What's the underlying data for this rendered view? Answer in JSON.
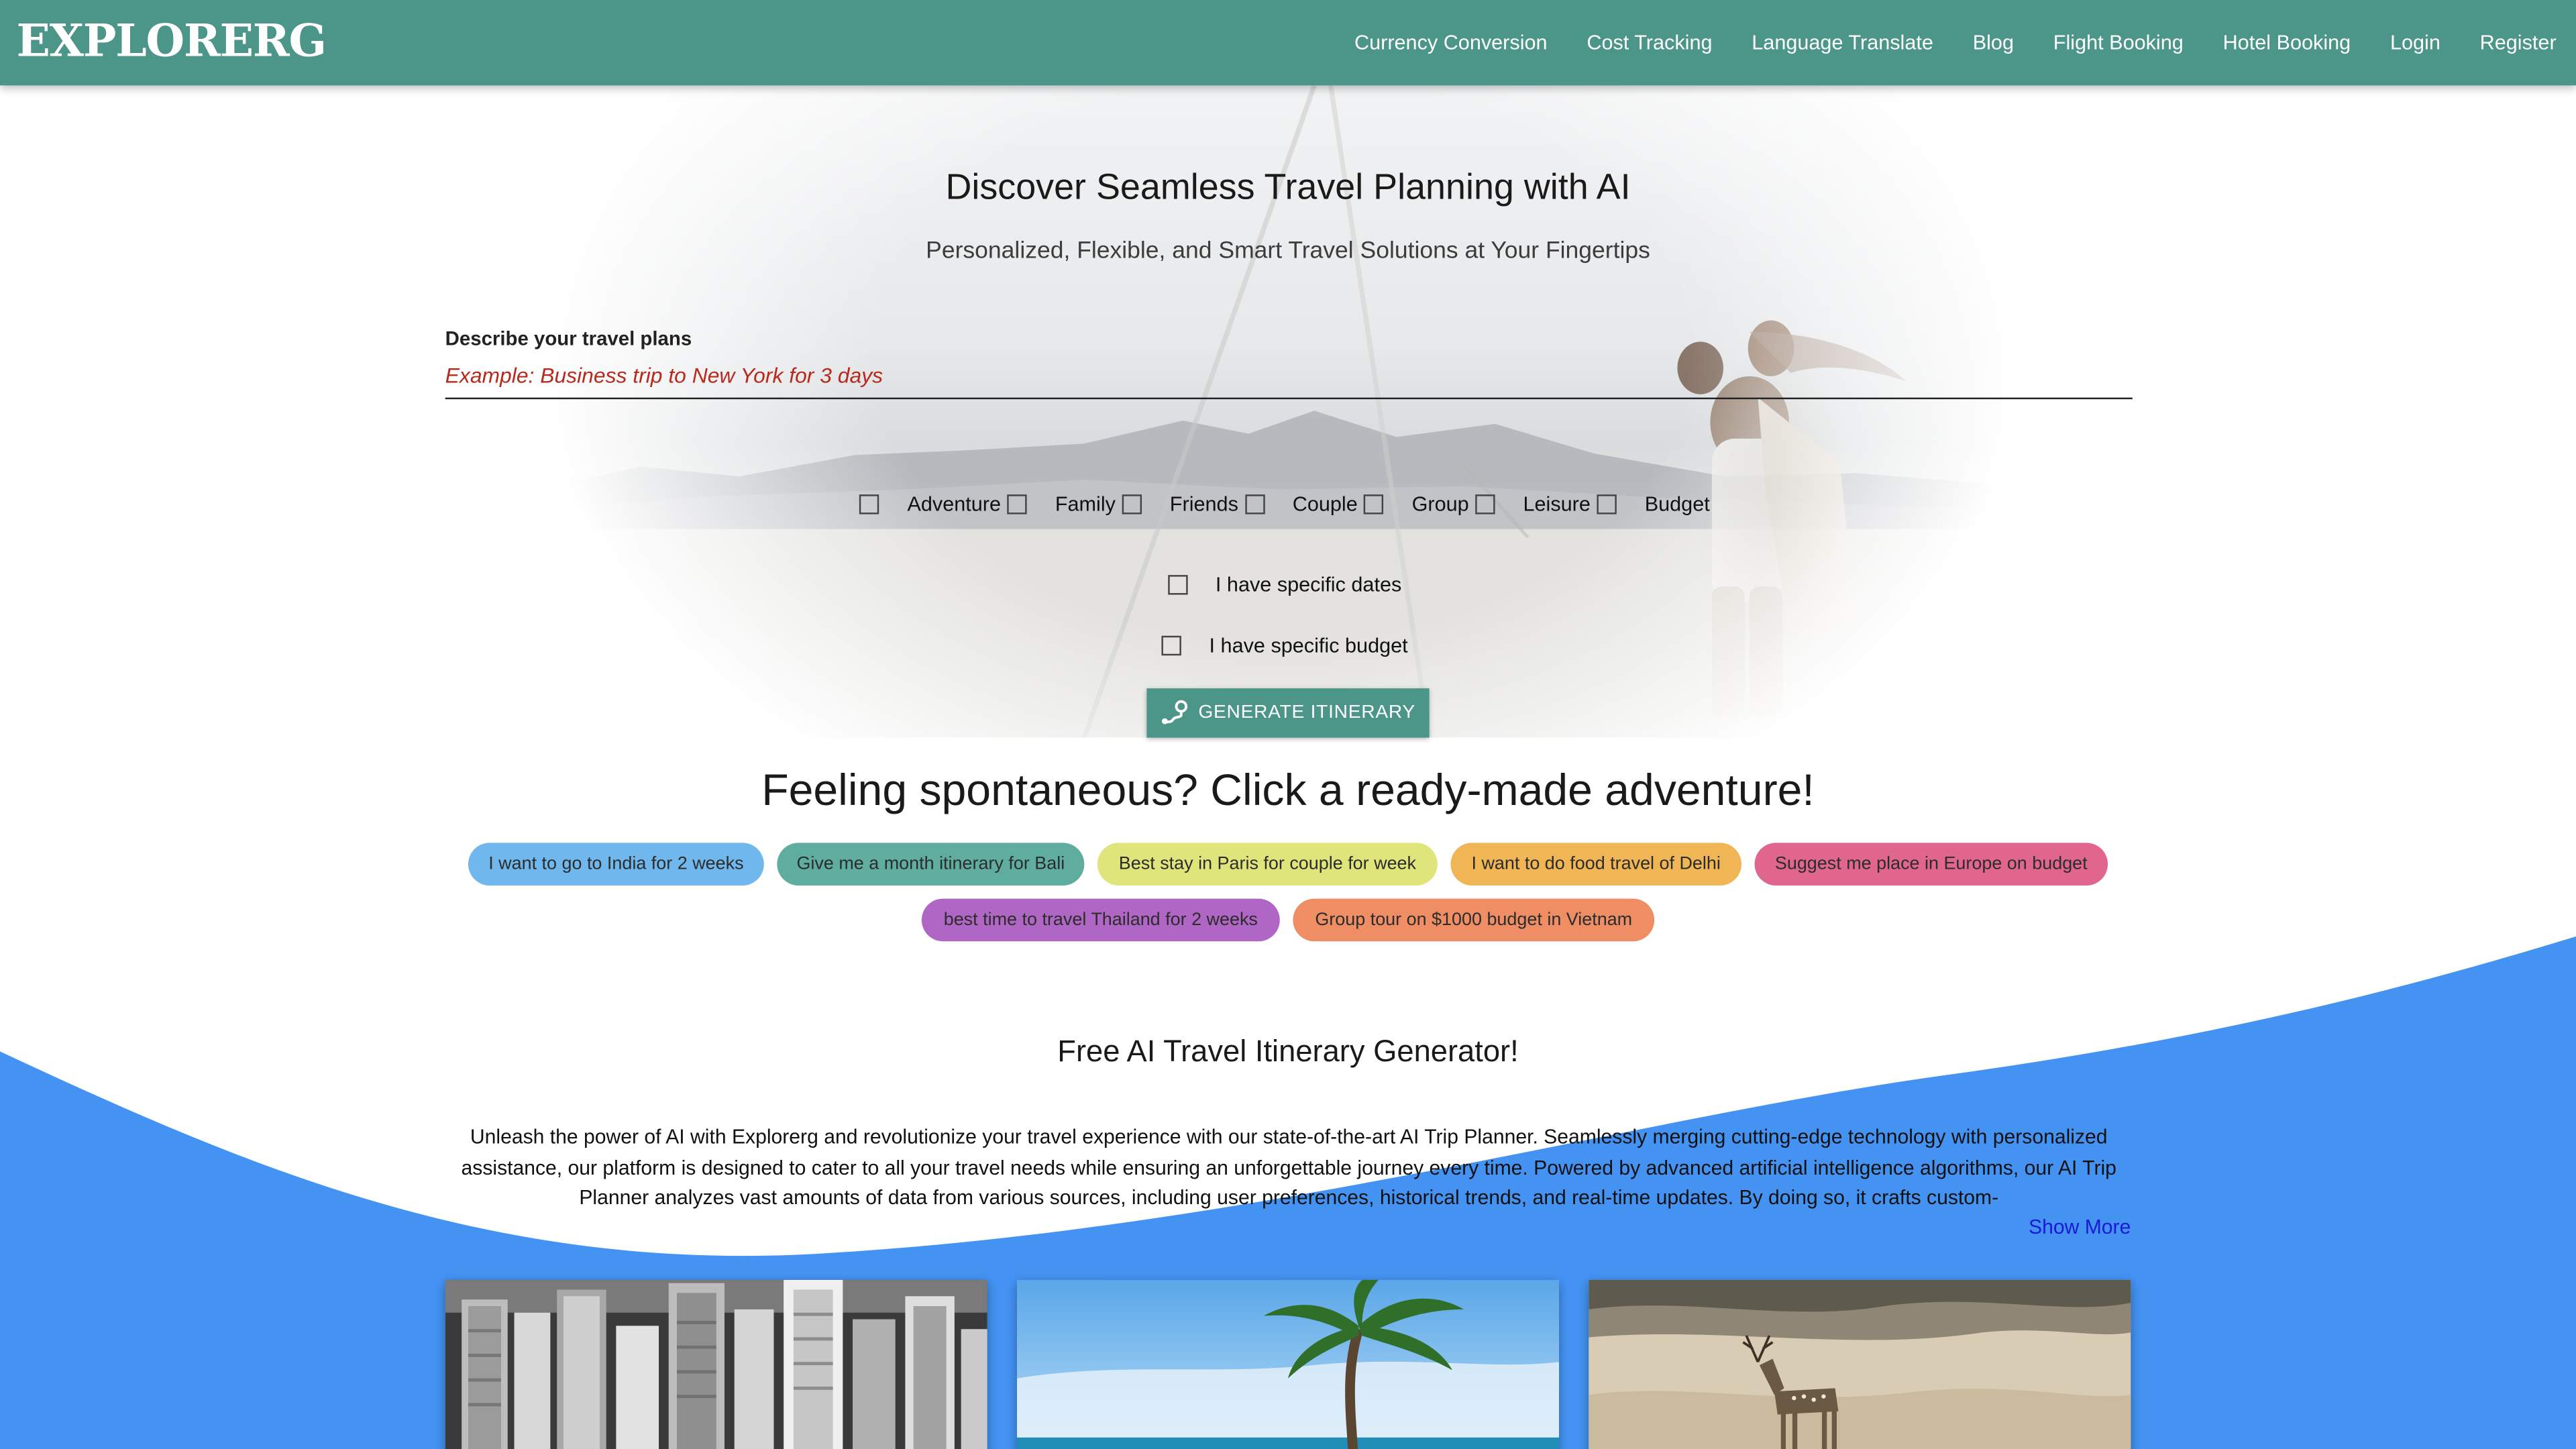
{
  "header": {
    "logo": "EXPLORERG",
    "nav": [
      "Currency Conversion",
      "Cost Tracking",
      "Language Translate",
      "Blog",
      "Flight Booking",
      "Hotel Booking",
      "Login",
      "Register"
    ]
  },
  "hero": {
    "title": "Discover Seamless Travel Planning with AI",
    "subtitle": "Personalized, Flexible, and Smart Travel Solutions at Your Fingertips",
    "input_label": "Describe your travel plans",
    "input_placeholder": "Example: Business trip to New York for 3 days",
    "input_value": "",
    "trip_types": [
      "Adventure",
      "Family",
      "Friends",
      "Couple",
      "Group",
      "Leisure",
      "Budget"
    ],
    "specific_dates_label": "I have specific dates",
    "specific_budget_label": "I have specific budget",
    "generate_button": "GENERATE ITINERARY"
  },
  "spontaneous": {
    "title": "Feeling spontaneous? Click a ready-made adventure!",
    "chips": [
      {
        "label": "I want to go to India for 2 weeks",
        "color": "#6fb7ec"
      },
      {
        "label": "Give me a month itinerary for Bali",
        "color": "#5fad9f"
      },
      {
        "label": "Best stay in Paris for couple for week",
        "color": "#dfe57b"
      },
      {
        "label": "I want to do food travel of Delhi",
        "color": "#f0b655"
      },
      {
        "label": "Suggest me place in Europe on budget",
        "color": "#e0668e"
      },
      {
        "label": "best time to travel Thailand for 2 weeks",
        "color": "#b066c4"
      },
      {
        "label": "Group tour on $1000 budget in Vietnam",
        "color": "#ef8e64"
      }
    ]
  },
  "free_generator": {
    "title": "Free AI Travel Itinerary Generator!",
    "body": "Unleash the power of AI with Explorerg and revolutionize your travel experience with our state-of-the-art AI Trip Planner. Seamlessly merging cutting-edge technology with personalized assistance, our platform is designed to cater to all your travel needs while ensuring an unforgettable journey every time. Powered by advanced artificial intelligence algorithms, our AI Trip Planner analyzes vast amounts of data from various sources, including user preferences, historical trends, and real-time updates. By doing so, it crafts custom-",
    "show_more": "Show More"
  },
  "colors": {
    "brand": "#4b9589",
    "wave_blue": "#4493f3",
    "placeholder_red": "#b8291b",
    "link_blue": "#1a1ad6"
  },
  "cards": [
    {
      "image": "city-skyline-grayscale"
    },
    {
      "image": "palm-tree-beach"
    },
    {
      "image": "deer-on-dunes"
    }
  ]
}
